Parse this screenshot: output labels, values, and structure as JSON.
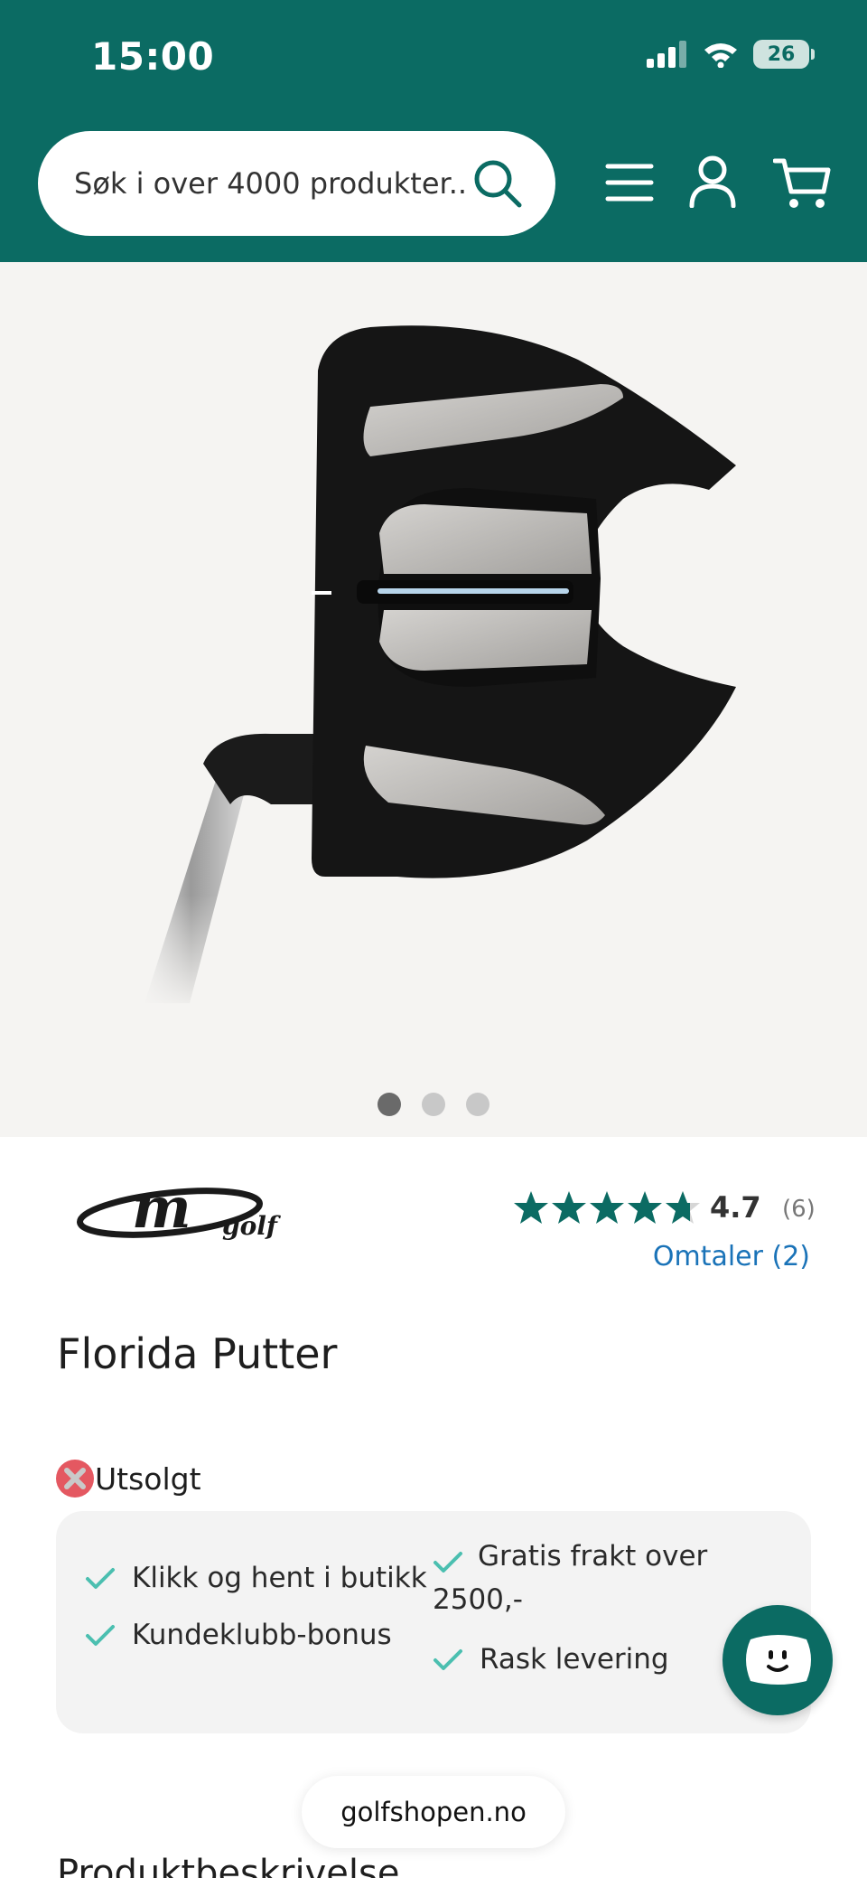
{
  "status_bar": {
    "time": "15:00",
    "battery": "26"
  },
  "header": {
    "search_placeholder": "Søk i over 4000 produkter..",
    "icons": [
      "search-icon",
      "menu-icon",
      "user-icon",
      "cart-icon"
    ]
  },
  "gallery": {
    "slides": 3,
    "active_slide": 1
  },
  "product": {
    "brand": "M golf",
    "rating": "4.7",
    "rating_count": "(6)",
    "rating_fraction": 0.94,
    "reviews_link": "Omtaler (2)",
    "title": "Florida Putter",
    "stock_status": "Utsolgt"
  },
  "benefits": {
    "item_1": "Klikk og hent i butikk",
    "item_2": "Kundeklubb-bonus",
    "item_3": "Gratis frakt over 2500,-",
    "item_4": "Rask levering"
  },
  "browser": {
    "domain": "golfshopen.no"
  },
  "sections": {
    "description_title": "Produktbeskrivelse"
  },
  "colors": {
    "brand_green": "#0b6b63",
    "link_blue": "#1a73b8",
    "check_teal": "#4bbfb0",
    "sold_out_red": "#e45861"
  }
}
